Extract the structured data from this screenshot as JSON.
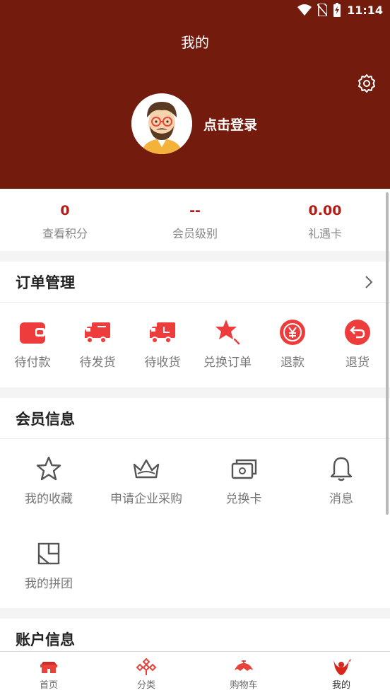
{
  "status_bar": {
    "time": "11:14"
  },
  "header": {
    "title": "我的",
    "login_text": "点击登录"
  },
  "stats": [
    {
      "value": "0",
      "label": "查看积分"
    },
    {
      "value": "--",
      "label": "会员级别"
    },
    {
      "value": "0.00",
      "label": "礼遇卡"
    }
  ],
  "orders": {
    "title": "订单管理",
    "items": [
      {
        "label": "待付款",
        "icon": "wallet-icon"
      },
      {
        "label": "待发货",
        "icon": "truck-icon"
      },
      {
        "label": "待收货",
        "icon": "delivery-truck-icon"
      },
      {
        "label": "兑换订单",
        "icon": "exchange-star-icon"
      },
      {
        "label": "退款",
        "icon": "yen-refund-icon"
      },
      {
        "label": "退货",
        "icon": "return-arrow-icon"
      }
    ]
  },
  "member": {
    "title": "会员信息",
    "items": [
      {
        "label": "我的收藏",
        "icon": "star-icon"
      },
      {
        "label": "申请企业采购",
        "icon": "crown-icon"
      },
      {
        "label": "兑换卡",
        "icon": "card-stack-icon"
      },
      {
        "label": "消息",
        "icon": "bell-icon"
      },
      {
        "label": "我的拼团",
        "icon": "group-buy-icon"
      }
    ]
  },
  "account": {
    "title": "账户信息"
  },
  "bottom_nav": [
    {
      "label": "首页",
      "icon": "home-icon"
    },
    {
      "label": "分类",
      "icon": "category-icon"
    },
    {
      "label": "购物车",
      "icon": "cart-icon"
    },
    {
      "label": "我的",
      "icon": "profile-icon",
      "active": true
    }
  ],
  "colors": {
    "header_bg": "#731b0c",
    "accent": "#b31b14",
    "icon_red": "#ee3b3b"
  }
}
